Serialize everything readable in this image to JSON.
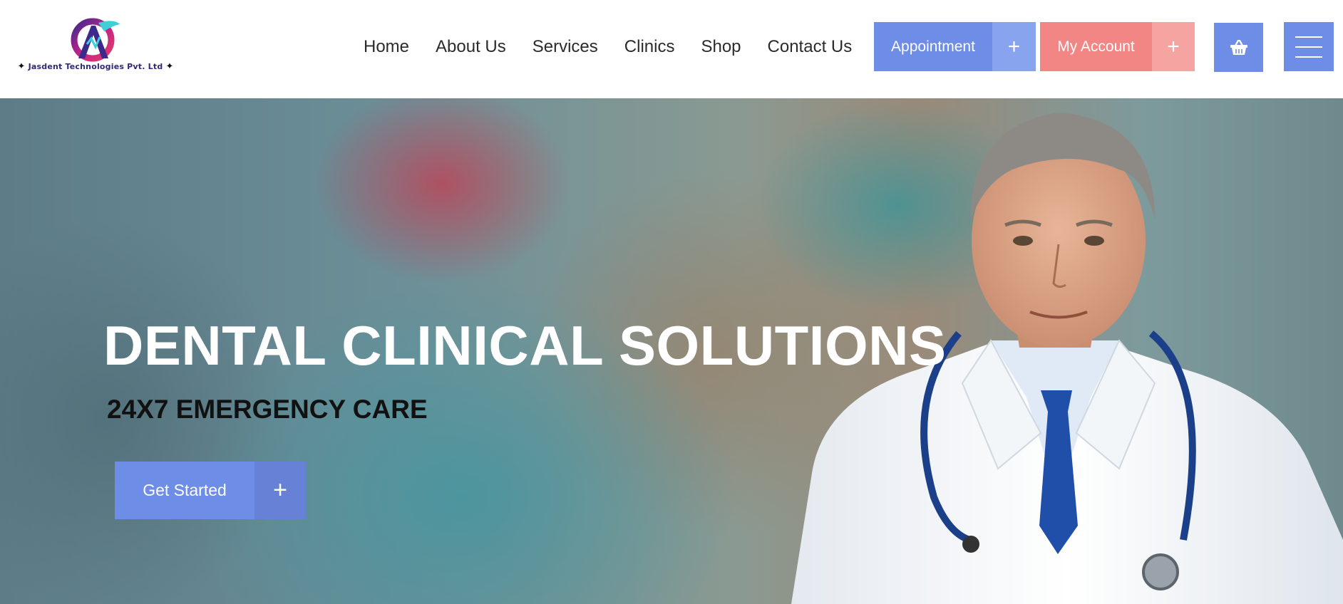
{
  "brand": {
    "name": "Jasdent Technologies Pvt. Ltd",
    "logo_icon": "jasdent-logo-icon"
  },
  "nav": {
    "items": [
      {
        "label": "Home"
      },
      {
        "label": "About Us"
      },
      {
        "label": "Services"
      },
      {
        "label": "Clinics"
      },
      {
        "label": "Shop"
      },
      {
        "label": "Contact Us"
      }
    ]
  },
  "header_actions": {
    "appointment_label": "Appointment",
    "account_label": "My Account",
    "plus_symbol": "+",
    "cart_icon": "basket-icon",
    "menu_icon": "hamburger-menu-icon"
  },
  "hero": {
    "title": "DENTAL CLINICAL SOLUTIONS",
    "subtitle": "24X7 EMERGENCY CARE",
    "cta_label": "Get Started",
    "cta_plus": "+"
  },
  "colors": {
    "primary_blue": "#6d8de7",
    "primary_blue_light": "#89a4ee",
    "accent_coral": "#f28684",
    "accent_coral_light": "#f6a4a1",
    "hero_title": "#ffffff"
  }
}
